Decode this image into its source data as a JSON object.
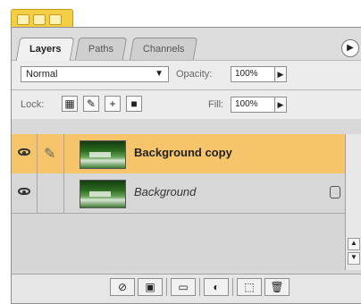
{
  "tabs": [
    "Layers",
    "Paths",
    "Channels"
  ],
  "blend_mode": "Normal",
  "opacity_label": "Opacity:",
  "opacity_value": "100%",
  "lock_label": "Lock:",
  "fill_label": "Fill:",
  "fill_value": "100%",
  "layers": [
    {
      "name": "Background copy",
      "selected": true
    },
    {
      "name": "Background",
      "selected": false
    }
  ],
  "colors": {
    "panel_bg": "#d9d9d9",
    "title_tab": "#f3cf47",
    "selected_layer": "#f6c56b"
  },
  "icons": {
    "panel_menu": "play-icon",
    "lock_transparency": "checkerboard-icon",
    "lock_image": "brush-icon",
    "lock_position": "move-icon",
    "lock_all": "lock-icon",
    "layer_style": "layer-style-icon",
    "mask": "mask-icon",
    "group": "folder-icon",
    "adjustment": "adjustment-icon",
    "new_layer": "new-layer-icon",
    "delete_layer": "trash-icon"
  }
}
